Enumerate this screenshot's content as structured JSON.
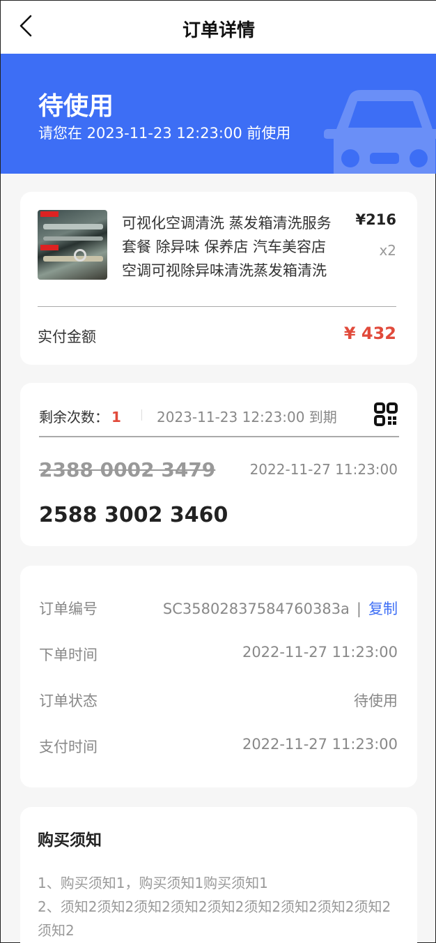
{
  "nav": {
    "title": "订单详情",
    "back_icon": "chevron-left-icon"
  },
  "banner": {
    "status": "待使用",
    "subtitle": "请您在 2023-11-23 12:23:00 前使用",
    "color": "#3d6ef5",
    "icon": "car-icon"
  },
  "product": {
    "title": "可视化空调清洗 蒸发箱清洗服务套餐 除异味 保养店 汽车美容店 空调可视除异味清洗蒸发箱清洗",
    "price": "¥216",
    "qty": "x2",
    "paid_label": "实付金额",
    "paid_amount": "¥ 432",
    "paid_color": "#e14a3b"
  },
  "usage": {
    "remain_label": "剩余次数：",
    "remain_count": "1",
    "expire_text": "2023-11-23 12:23:00 到期",
    "qr_icon": "qr-code-icon",
    "used_code": "2388 0002 3479",
    "used_time": "2022-11-27 11:23:00",
    "active_code": "2588 3002 3460"
  },
  "order_info": {
    "rows": [
      {
        "label": "订单编号",
        "value": "SC35802837584760383a"
      },
      {
        "label": "下单时间",
        "value": "2022-11-27 11:23:00"
      },
      {
        "label": "订单状态",
        "value": "待使用"
      },
      {
        "label": "支付时间",
        "value": "2022-11-27 11:23:00"
      }
    ],
    "separator": "|",
    "copy_label": "复制",
    "link_color": "#3d6ef5"
  },
  "notice": {
    "title": "购买须知",
    "lines": [
      "1、购买须知1，购买须知1购买须知1",
      "2、须知2须知2须知2须知2须知2须知2须知2须知2须知2须知2"
    ]
  }
}
